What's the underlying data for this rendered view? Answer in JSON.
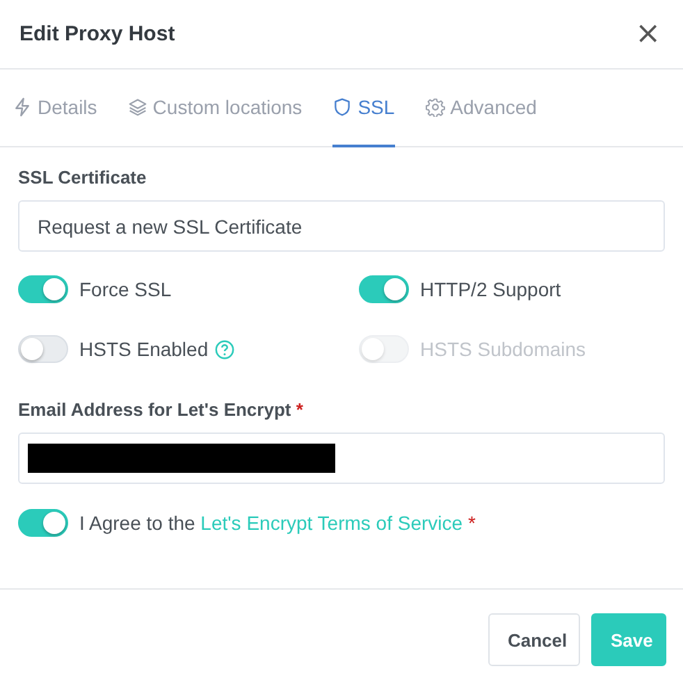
{
  "dialog": {
    "title": "Edit Proxy Host",
    "close": "×"
  },
  "tabs": [
    {
      "label": "Details",
      "kind": "bolt",
      "selected": false
    },
    {
      "label": "Custom locations",
      "kind": "layers",
      "selected": false
    },
    {
      "label": "SSL",
      "kind": "shield",
      "selected": true
    },
    {
      "label": "Advanced",
      "kind": "gear",
      "selected": false
    }
  ],
  "ssl_certificate": {
    "label": "SSL Certificate",
    "value": "Request a new SSL Certificate"
  },
  "toggles": [
    {
      "label": "Force SSL",
      "on": true,
      "disabled": false,
      "help": false
    },
    {
      "label": "HTTP/2 Support",
      "on": true,
      "disabled": false,
      "help": false
    },
    {
      "label": "HSTS Enabled",
      "on": false,
      "disabled": false,
      "help": true
    },
    {
      "label": "HSTS Subdomains",
      "on": false,
      "disabled": true,
      "help": false
    }
  ],
  "email": {
    "label": "Email Address for Let's Encrypt",
    "required_mark": "*",
    "redacted": true
  },
  "agree": {
    "on": true,
    "text": "I Agree to the ",
    "link": "Let's Encrypt Terms of Service",
    "required_mark": "*"
  },
  "buttons": [
    {
      "label": "Cancel",
      "kind": "secondary"
    },
    {
      "label": "Save",
      "kind": "primary"
    }
  ]
}
